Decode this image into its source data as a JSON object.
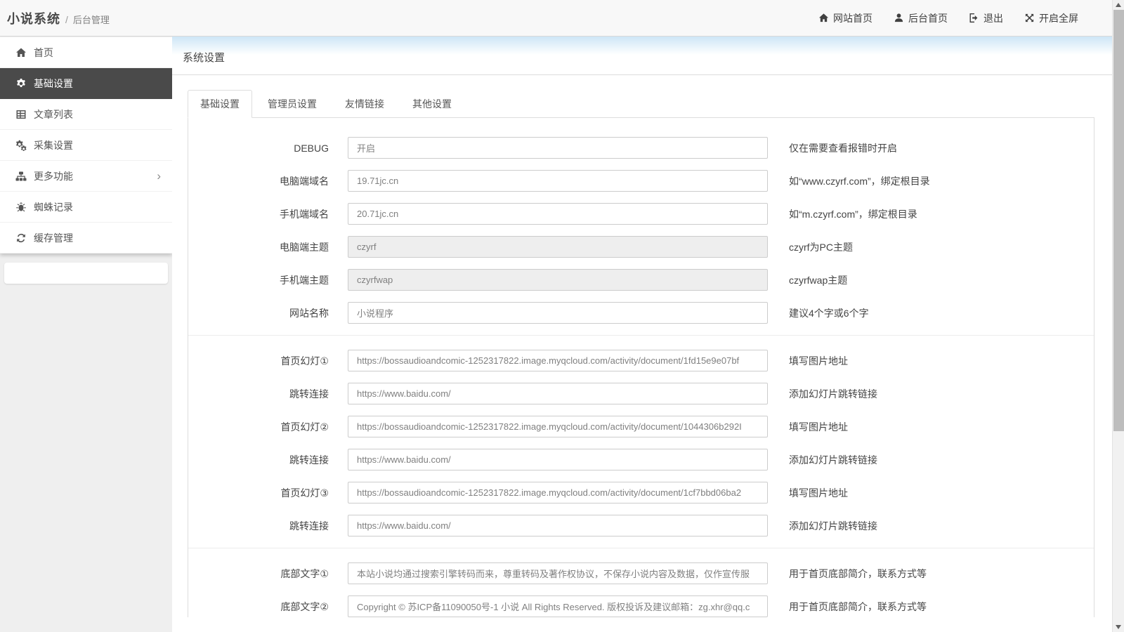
{
  "header": {
    "brand": "小说系统",
    "separator": "/",
    "breadcrumb": "后台管理",
    "nav": [
      {
        "label": "网站首页",
        "icon": "home-icon"
      },
      {
        "label": "后台首页",
        "icon": "user-icon"
      },
      {
        "label": "退出",
        "icon": "sign-out-icon"
      },
      {
        "label": "开启全屏",
        "icon": "fullscreen-icon"
      }
    ]
  },
  "sidebar": {
    "items": [
      {
        "label": "首页",
        "icon": "home-icon",
        "active": false
      },
      {
        "label": "基础设置",
        "icon": "gear-icon",
        "active": true
      },
      {
        "label": "文章列表",
        "icon": "table-icon",
        "active": false
      },
      {
        "label": "采集设置",
        "icon": "cogs-icon",
        "active": false
      },
      {
        "label": "更多功能",
        "icon": "sitemap-icon",
        "active": false,
        "has_submenu": true,
        "chevron": "›"
      },
      {
        "label": "蜘蛛记录",
        "icon": "bug-icon",
        "active": false
      },
      {
        "label": "缓存管理",
        "icon": "refresh-icon",
        "active": false
      }
    ]
  },
  "main": {
    "title": "系统设置",
    "tabs": [
      {
        "label": "基础设置",
        "active": true
      },
      {
        "label": "管理员设置",
        "active": false
      },
      {
        "label": "友情链接",
        "active": false
      },
      {
        "label": "其他设置",
        "active": false
      }
    ],
    "form": {
      "rows": [
        {
          "label": "DEBUG",
          "value": "开启",
          "hint": "仅在需要查看报错时开启",
          "disabled": false
        },
        {
          "label": "电脑端域名",
          "value": "19.71jc.cn",
          "hint": "如“www.czyrf.com”，绑定根目录",
          "disabled": false
        },
        {
          "label": "手机端域名",
          "value": "20.71jc.cn",
          "hint": "如“m.czyrf.com”，绑定根目录",
          "disabled": false
        },
        {
          "label": "电脑端主题",
          "value": "czyrf",
          "hint": "czyrf为PC主题",
          "disabled": true
        },
        {
          "label": "手机端主题",
          "value": "czyrfwap",
          "hint": "czyrfwap主题",
          "disabled": true
        },
        {
          "label": "网站名称",
          "value": "小说程序",
          "hint": "建议4个字或6个字",
          "disabled": false
        },
        {
          "label": "首页幻灯①",
          "value": "https://bossaudioandcomic-1252317822.image.myqcloud.com/activity/document/1fd15e9e07bf",
          "hint": "填写图片地址",
          "disabled": false
        },
        {
          "label": "跳转连接",
          "value": "https://www.baidu.com/",
          "hint": "添加幻灯片跳转链接",
          "disabled": false
        },
        {
          "label": "首页幻灯②",
          "value": "https://bossaudioandcomic-1252317822.image.myqcloud.com/activity/document/1044306b292I",
          "hint": "填写图片地址",
          "disabled": false
        },
        {
          "label": "跳转连接",
          "value": "https://www.baidu.com/",
          "hint": "添加幻灯片跳转链接",
          "disabled": false
        },
        {
          "label": "首页幻灯③",
          "value": "https://bossaudioandcomic-1252317822.image.myqcloud.com/activity/document/1cf7bbd06ba2",
          "hint": "填写图片地址",
          "disabled": false
        },
        {
          "label": "跳转连接",
          "value": "https://www.baidu.com/",
          "hint": "添加幻灯片跳转链接",
          "disabled": false
        },
        {
          "label": "底部文字①",
          "value": "本站小说均通过搜索引擎转码而来，尊重转码及著作权协议，不保存小说内容及数据，仅作宣传服",
          "hint": "用于首页底部简介，联系方式等",
          "disabled": false
        },
        {
          "label": "底部文字②",
          "value": "Copyright © 苏ICP备11090050号-1 小说 All Rights Reserved. 版权投诉及建议邮箱：zg.xhr@qq.c",
          "hint": "用于首页底部简介，联系方式等",
          "disabled": false
        }
      ]
    }
  },
  "colors": {
    "sidebar_active_bg": "#4a4a4a",
    "panel_gradient_top": "#cde5f6",
    "header_bg": "#f8f8f8",
    "page_bg": "#efefef",
    "input_border": "#cccccc",
    "disabled_input_bg": "#eeeeee"
  }
}
